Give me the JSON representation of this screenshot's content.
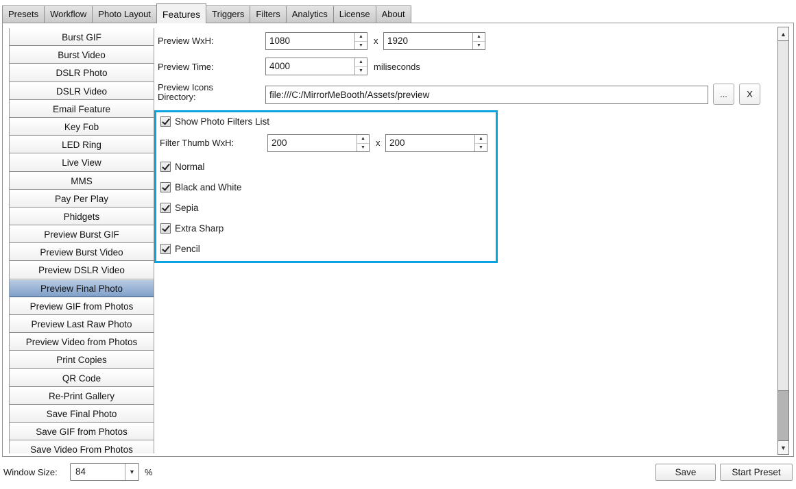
{
  "tabs": [
    {
      "label": "Presets",
      "active": false
    },
    {
      "label": "Workflow",
      "active": false
    },
    {
      "label": "Photo Layout",
      "active": false
    },
    {
      "label": "Features",
      "active": true
    },
    {
      "label": "Triggers",
      "active": false
    },
    {
      "label": "Filters",
      "active": false
    },
    {
      "label": "Analytics",
      "active": false
    },
    {
      "label": "License",
      "active": false
    },
    {
      "label": "About",
      "active": false
    }
  ],
  "features": {
    "selected": "Preview Final Photo",
    "items": [
      "Burst GIF",
      "Burst Video",
      "DSLR Photo",
      "DSLR Video",
      "Email Feature",
      "Key Fob",
      "LED Ring",
      "Live View",
      "MMS",
      "Pay Per Play",
      "Phidgets",
      "Preview Burst GIF",
      "Preview Burst Video",
      "Preview DSLR Video",
      "Preview Final Photo",
      "Preview GIF from Photos",
      "Preview Last Raw Photo",
      "Preview Video from Photos",
      "Print Copies",
      "QR Code",
      "Re-Print Gallery",
      "Save Final Photo",
      "Save GIF from Photos",
      "Save Video From Photos"
    ]
  },
  "settings": {
    "preview_wxh": {
      "label": "Preview WxH:",
      "width": "1080",
      "separator": "x",
      "height": "1920"
    },
    "preview_time": {
      "label": "Preview Time:",
      "value": "4000",
      "unit": "miliseconds"
    },
    "preview_icons_dir": {
      "label_line1": "Preview Icons",
      "label_line2": "Directory:",
      "value": "file:///C:/MirrorMeBooth/Assets/preview",
      "browse_label": "...",
      "clear_label": "X"
    },
    "show_filters": {
      "label": "Show Photo Filters List",
      "checked": true
    },
    "filter_thumb": {
      "label": "Filter Thumb WxH:",
      "width": "200",
      "separator": "x",
      "height": "200"
    },
    "filters": [
      {
        "label": "Normal",
        "checked": true
      },
      {
        "label": "Black and White",
        "checked": true
      },
      {
        "label": "Sepia",
        "checked": true
      },
      {
        "label": "Extra Sharp",
        "checked": true
      },
      {
        "label": "Pencil",
        "checked": true
      }
    ]
  },
  "icons": {
    "up": "▲",
    "down": "▼",
    "spin_up": "▲",
    "spin_down": "▼"
  },
  "footer": {
    "window_size_label": "Window Size:",
    "window_size_value": "84",
    "percent": "%",
    "save_label": "Save",
    "start_preset_label": "Start Preset"
  },
  "colors": {
    "highlight": "#0aa3e0",
    "selected_item": "#8fa9cf"
  }
}
